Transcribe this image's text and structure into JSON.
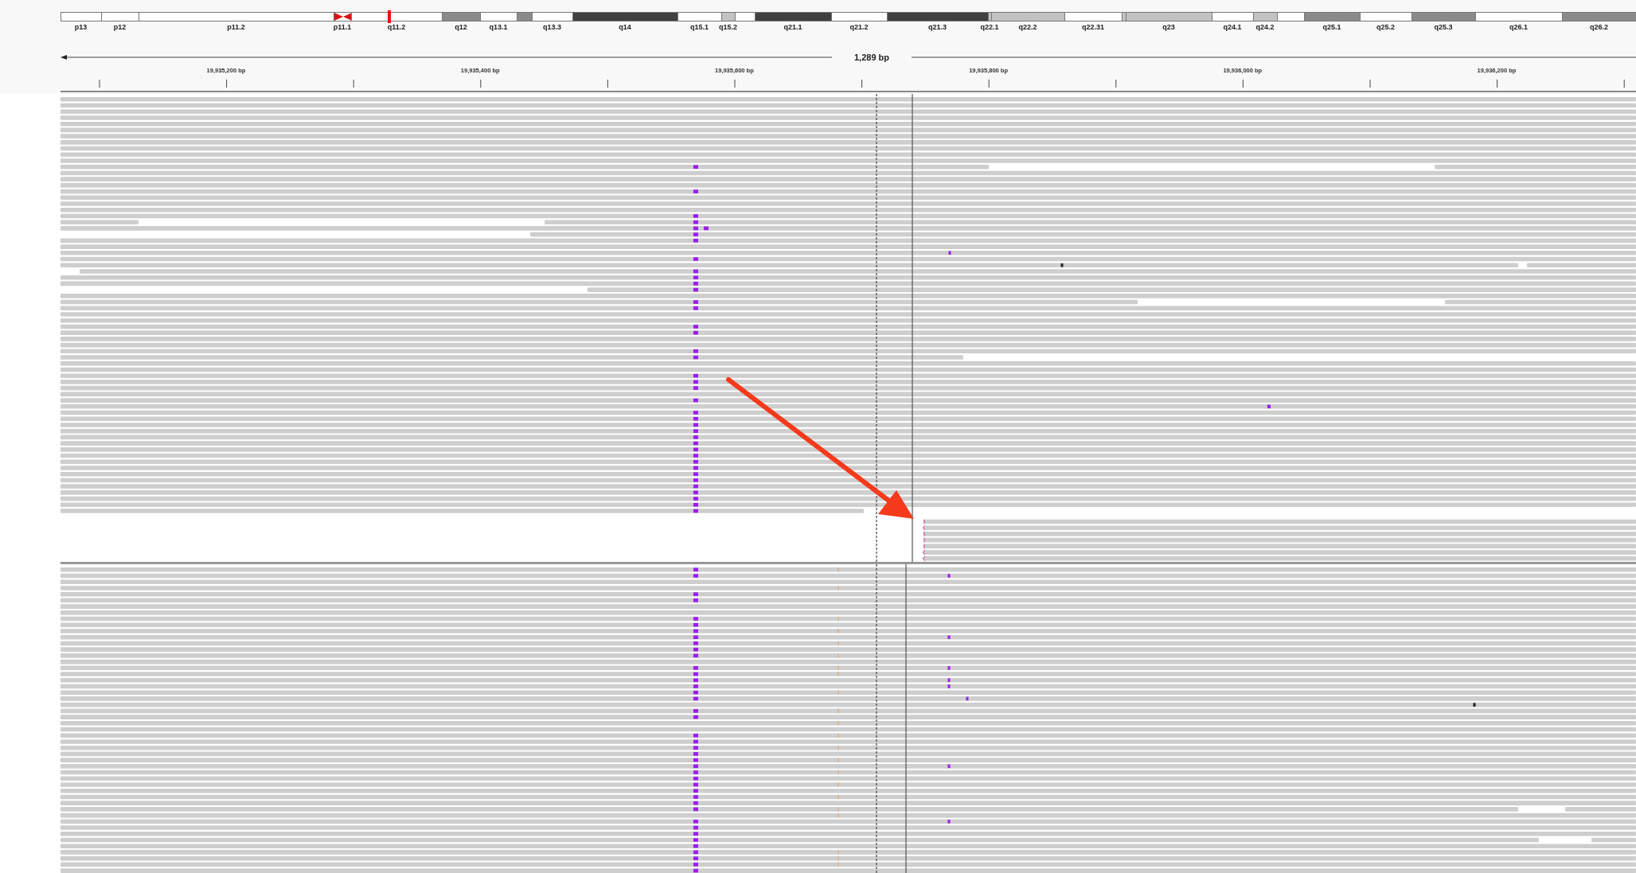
{
  "ideogram": {
    "bands": [
      {
        "label": "p13",
        "kind": "gneg",
        "current": false
      },
      {
        "label": "p12",
        "kind": "gneg",
        "current": false
      },
      {
        "label": "p11.2",
        "kind": "gneg",
        "current": false
      },
      {
        "label": "p11.1",
        "kind": "acen",
        "current": false
      },
      {
        "label": "q11.2",
        "kind": "gneg",
        "current": true
      },
      {
        "label": "q12",
        "kind": "gpos50",
        "current": false
      },
      {
        "label": "q13.1",
        "kind": "gneg",
        "current": false
      },
      {
        "kind": "gpos50",
        "current": false
      },
      {
        "label": "q13.3",
        "kind": "gneg",
        "current": false
      },
      {
        "label": "q14",
        "kind": "gpos100",
        "current": false
      },
      {
        "label": "q15.1",
        "kind": "gneg",
        "current": false
      },
      {
        "label": "q15.2",
        "kind": "gpos25",
        "current": false
      },
      {
        "kind": "gneg",
        "current": false
      },
      {
        "label": "q21.1",
        "kind": "gpos100",
        "current": false
      },
      {
        "label": "q21.2",
        "kind": "gneg",
        "current": false
      },
      {
        "label": "q21.3",
        "kind": "gpos100",
        "current": false
      },
      {
        "label": "q22.1",
        "kind": "gpos25",
        "current": false
      },
      {
        "label": "q22.2",
        "kind": "gpos25",
        "current": false
      },
      {
        "label": "q22.31",
        "kind": "gneg",
        "current": false
      },
      {
        "kind": "gpos25",
        "current": false
      },
      {
        "label": "q23",
        "kind": "gpos25",
        "current": false
      },
      {
        "label": "q24.1",
        "kind": "gneg",
        "current": false
      },
      {
        "label": "q24.2",
        "kind": "gpos25",
        "current": false
      },
      {
        "kind": "gneg",
        "current": false
      },
      {
        "label": "q25.1",
        "kind": "gpos50",
        "current": false
      },
      {
        "label": "q25.2",
        "kind": "gneg",
        "current": false
      },
      {
        "label": "q25.3",
        "kind": "gpos50",
        "current": false
      },
      {
        "label": "q26.1",
        "kind": "gneg",
        "current": false
      },
      {
        "label": "q26.2",
        "kind": "gpos50",
        "current": false
      }
    ]
  },
  "ruler": {
    "span_label": "1,289 bp",
    "tick_labels": [
      "19,935,200 bp",
      "19,935,400 bp",
      "19,935,600 bp",
      "19,935,800 bp",
      "19,936,000 bp",
      "19,936,200 bp"
    ]
  }
}
